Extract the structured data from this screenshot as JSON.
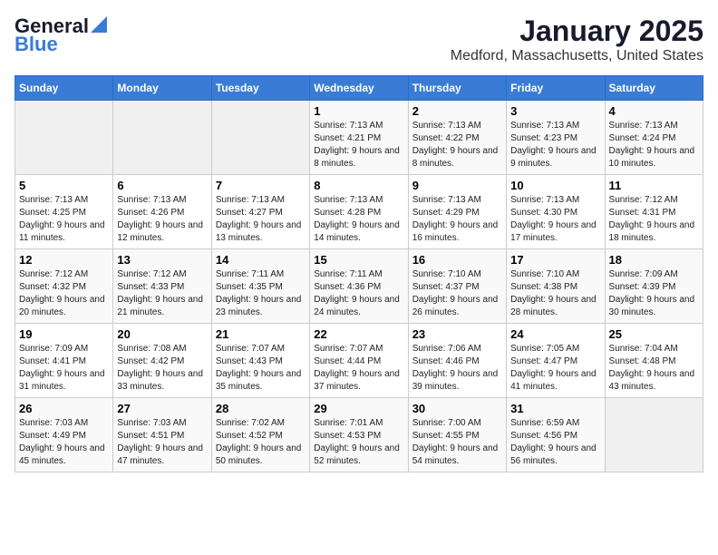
{
  "logo": {
    "line1": "General",
    "line2": "Blue"
  },
  "title": "January 2025",
  "subtitle": "Medford, Massachusetts, United States",
  "days_of_week": [
    "Sunday",
    "Monday",
    "Tuesday",
    "Wednesday",
    "Thursday",
    "Friday",
    "Saturday"
  ],
  "weeks": [
    [
      {
        "day": "",
        "sunrise": "",
        "sunset": "",
        "daylight": "",
        "empty": true
      },
      {
        "day": "",
        "sunrise": "",
        "sunset": "",
        "daylight": "",
        "empty": true
      },
      {
        "day": "",
        "sunrise": "",
        "sunset": "",
        "daylight": "",
        "empty": true
      },
      {
        "day": "1",
        "sunrise": "Sunrise: 7:13 AM",
        "sunset": "Sunset: 4:21 PM",
        "daylight": "Daylight: 9 hours and 8 minutes."
      },
      {
        "day": "2",
        "sunrise": "Sunrise: 7:13 AM",
        "sunset": "Sunset: 4:22 PM",
        "daylight": "Daylight: 9 hours and 8 minutes."
      },
      {
        "day": "3",
        "sunrise": "Sunrise: 7:13 AM",
        "sunset": "Sunset: 4:23 PM",
        "daylight": "Daylight: 9 hours and 9 minutes."
      },
      {
        "day": "4",
        "sunrise": "Sunrise: 7:13 AM",
        "sunset": "Sunset: 4:24 PM",
        "daylight": "Daylight: 9 hours and 10 minutes."
      }
    ],
    [
      {
        "day": "5",
        "sunrise": "Sunrise: 7:13 AM",
        "sunset": "Sunset: 4:25 PM",
        "daylight": "Daylight: 9 hours and 11 minutes."
      },
      {
        "day": "6",
        "sunrise": "Sunrise: 7:13 AM",
        "sunset": "Sunset: 4:26 PM",
        "daylight": "Daylight: 9 hours and 12 minutes."
      },
      {
        "day": "7",
        "sunrise": "Sunrise: 7:13 AM",
        "sunset": "Sunset: 4:27 PM",
        "daylight": "Daylight: 9 hours and 13 minutes."
      },
      {
        "day": "8",
        "sunrise": "Sunrise: 7:13 AM",
        "sunset": "Sunset: 4:28 PM",
        "daylight": "Daylight: 9 hours and 14 minutes."
      },
      {
        "day": "9",
        "sunrise": "Sunrise: 7:13 AM",
        "sunset": "Sunset: 4:29 PM",
        "daylight": "Daylight: 9 hours and 16 minutes."
      },
      {
        "day": "10",
        "sunrise": "Sunrise: 7:13 AM",
        "sunset": "Sunset: 4:30 PM",
        "daylight": "Daylight: 9 hours and 17 minutes."
      },
      {
        "day": "11",
        "sunrise": "Sunrise: 7:12 AM",
        "sunset": "Sunset: 4:31 PM",
        "daylight": "Daylight: 9 hours and 18 minutes."
      }
    ],
    [
      {
        "day": "12",
        "sunrise": "Sunrise: 7:12 AM",
        "sunset": "Sunset: 4:32 PM",
        "daylight": "Daylight: 9 hours and 20 minutes."
      },
      {
        "day": "13",
        "sunrise": "Sunrise: 7:12 AM",
        "sunset": "Sunset: 4:33 PM",
        "daylight": "Daylight: 9 hours and 21 minutes."
      },
      {
        "day": "14",
        "sunrise": "Sunrise: 7:11 AM",
        "sunset": "Sunset: 4:35 PM",
        "daylight": "Daylight: 9 hours and 23 minutes."
      },
      {
        "day": "15",
        "sunrise": "Sunrise: 7:11 AM",
        "sunset": "Sunset: 4:36 PM",
        "daylight": "Daylight: 9 hours and 24 minutes."
      },
      {
        "day": "16",
        "sunrise": "Sunrise: 7:10 AM",
        "sunset": "Sunset: 4:37 PM",
        "daylight": "Daylight: 9 hours and 26 minutes."
      },
      {
        "day": "17",
        "sunrise": "Sunrise: 7:10 AM",
        "sunset": "Sunset: 4:38 PM",
        "daylight": "Daylight: 9 hours and 28 minutes."
      },
      {
        "day": "18",
        "sunrise": "Sunrise: 7:09 AM",
        "sunset": "Sunset: 4:39 PM",
        "daylight": "Daylight: 9 hours and 30 minutes."
      }
    ],
    [
      {
        "day": "19",
        "sunrise": "Sunrise: 7:09 AM",
        "sunset": "Sunset: 4:41 PM",
        "daylight": "Daylight: 9 hours and 31 minutes."
      },
      {
        "day": "20",
        "sunrise": "Sunrise: 7:08 AM",
        "sunset": "Sunset: 4:42 PM",
        "daylight": "Daylight: 9 hours and 33 minutes."
      },
      {
        "day": "21",
        "sunrise": "Sunrise: 7:07 AM",
        "sunset": "Sunset: 4:43 PM",
        "daylight": "Daylight: 9 hours and 35 minutes."
      },
      {
        "day": "22",
        "sunrise": "Sunrise: 7:07 AM",
        "sunset": "Sunset: 4:44 PM",
        "daylight": "Daylight: 9 hours and 37 minutes."
      },
      {
        "day": "23",
        "sunrise": "Sunrise: 7:06 AM",
        "sunset": "Sunset: 4:46 PM",
        "daylight": "Daylight: 9 hours and 39 minutes."
      },
      {
        "day": "24",
        "sunrise": "Sunrise: 7:05 AM",
        "sunset": "Sunset: 4:47 PM",
        "daylight": "Daylight: 9 hours and 41 minutes."
      },
      {
        "day": "25",
        "sunrise": "Sunrise: 7:04 AM",
        "sunset": "Sunset: 4:48 PM",
        "daylight": "Daylight: 9 hours and 43 minutes."
      }
    ],
    [
      {
        "day": "26",
        "sunrise": "Sunrise: 7:03 AM",
        "sunset": "Sunset: 4:49 PM",
        "daylight": "Daylight: 9 hours and 45 minutes."
      },
      {
        "day": "27",
        "sunrise": "Sunrise: 7:03 AM",
        "sunset": "Sunset: 4:51 PM",
        "daylight": "Daylight: 9 hours and 47 minutes."
      },
      {
        "day": "28",
        "sunrise": "Sunrise: 7:02 AM",
        "sunset": "Sunset: 4:52 PM",
        "daylight": "Daylight: 9 hours and 50 minutes."
      },
      {
        "day": "29",
        "sunrise": "Sunrise: 7:01 AM",
        "sunset": "Sunset: 4:53 PM",
        "daylight": "Daylight: 9 hours and 52 minutes."
      },
      {
        "day": "30",
        "sunrise": "Sunrise: 7:00 AM",
        "sunset": "Sunset: 4:55 PM",
        "daylight": "Daylight: 9 hours and 54 minutes."
      },
      {
        "day": "31",
        "sunrise": "Sunrise: 6:59 AM",
        "sunset": "Sunset: 4:56 PM",
        "daylight": "Daylight: 9 hours and 56 minutes."
      },
      {
        "day": "",
        "sunrise": "",
        "sunset": "",
        "daylight": "",
        "empty": true
      }
    ]
  ]
}
